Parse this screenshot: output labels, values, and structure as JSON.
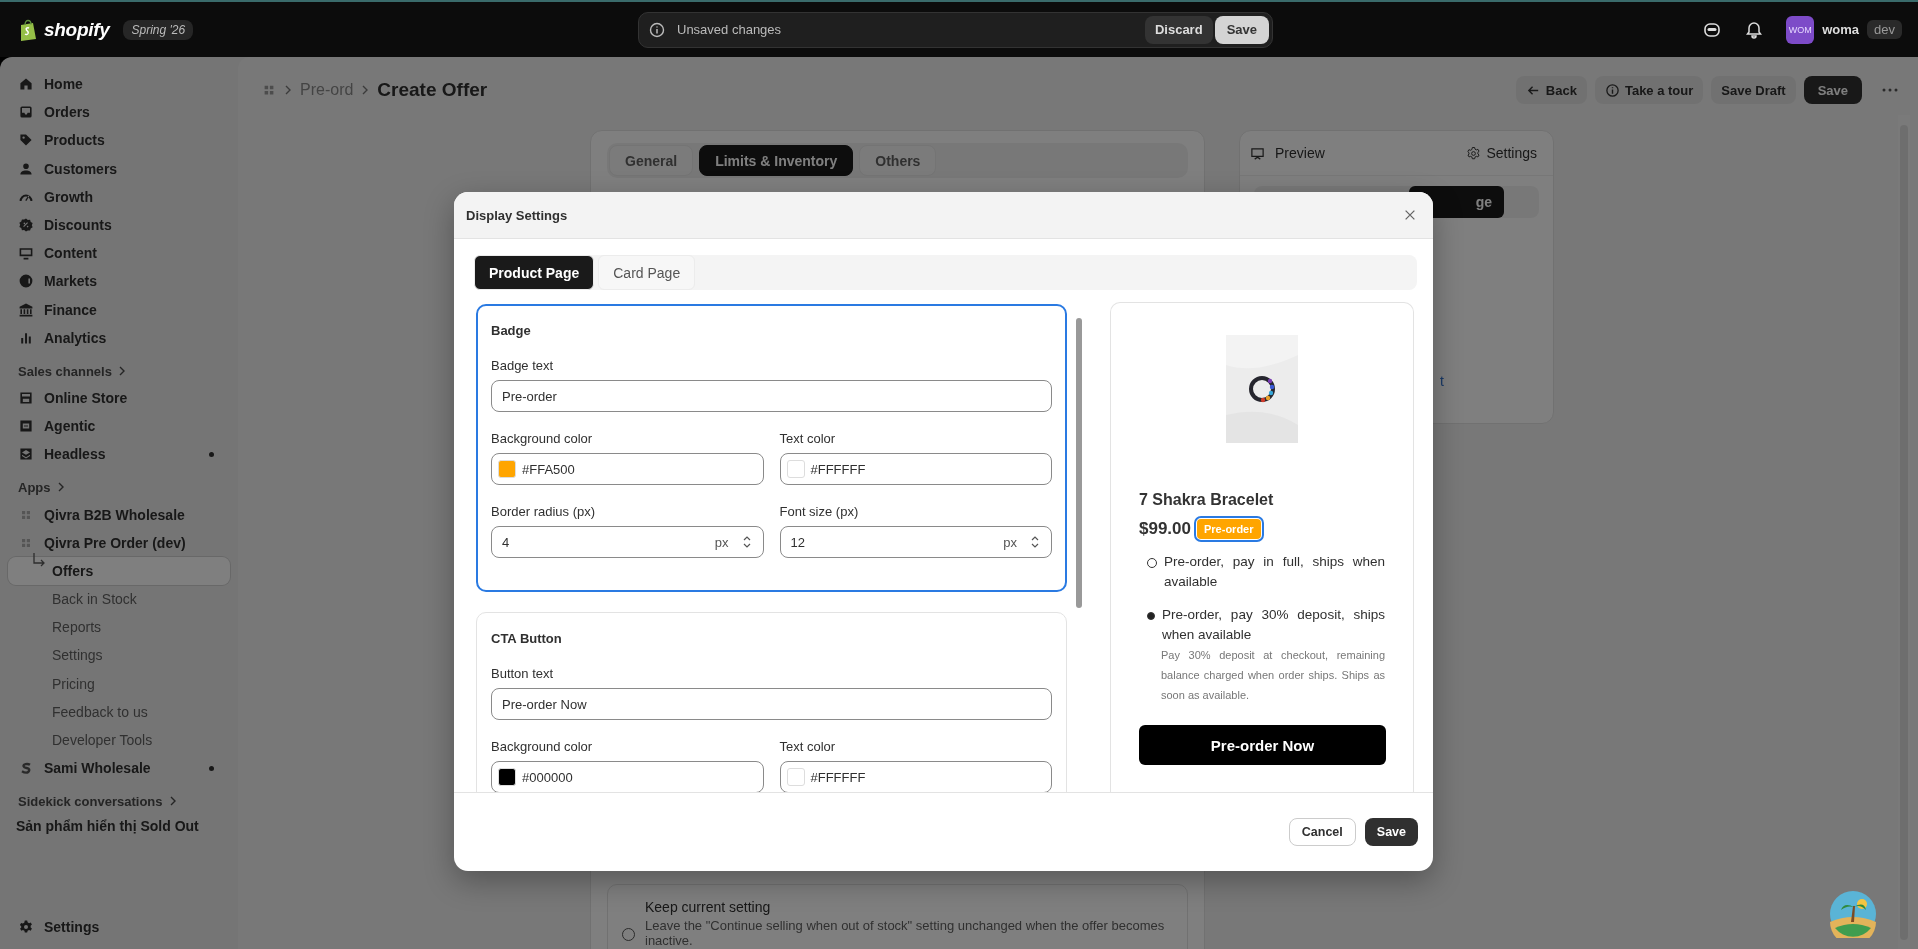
{
  "topbar": {
    "logo_text": "shopify",
    "store_badge": "Spring '26",
    "unsaved": {
      "message": "Unsaved changes",
      "discard": "Discard",
      "save": "Save"
    },
    "avatar": "WOM",
    "user": "woma",
    "env_badge": "dev"
  },
  "sidebar": {
    "main_items": [
      {
        "label": "Home",
        "selected": false
      },
      {
        "label": "Orders",
        "selected": false
      },
      {
        "label": "Products",
        "selected": false
      },
      {
        "label": "Customers",
        "selected": false
      },
      {
        "label": "Growth",
        "selected": false
      },
      {
        "label": "Discounts",
        "selected": false
      },
      {
        "label": "Content",
        "selected": false
      },
      {
        "label": "Markets",
        "selected": false
      },
      {
        "label": "Finance",
        "selected": false
      },
      {
        "label": "Analytics",
        "selected": false
      }
    ],
    "sales_channels": {
      "heading": "Sales channels",
      "items": [
        {
          "label": "Online Store",
          "selected": false,
          "dot": false
        },
        {
          "label": "Agentic",
          "selected": false,
          "dot": false
        },
        {
          "label": "Headless",
          "selected": false,
          "dot": true
        }
      ]
    },
    "apps": {
      "heading": "Apps",
      "items": [
        {
          "label": "Qivra B2B Wholesale",
          "selected": false,
          "dot": false
        },
        {
          "label": "Qivra Pre Order (dev)",
          "selected": false,
          "dot": false,
          "children": [
            {
              "label": "Offers",
              "selected": true
            },
            {
              "label": "Back in Stock",
              "selected": false
            },
            {
              "label": "Reports",
              "selected": false
            },
            {
              "label": "Settings",
              "selected": false
            },
            {
              "label": "Pricing",
              "selected": false
            },
            {
              "label": "Feedback to us",
              "selected": false
            },
            {
              "label": "Developer Tools",
              "selected": false
            }
          ]
        },
        {
          "label": "Sami Wholesale",
          "selected": false,
          "dot": true
        }
      ]
    },
    "sidekick": {
      "heading": "Sidekick conversations",
      "items": [
        "Sản phẩm hiển thị Sold Out"
      ]
    },
    "footer_item": "Settings"
  },
  "page_header": {
    "crumb": "Pre-ord",
    "title": "Create Offer",
    "actions": [
      "Back",
      "Take a tour",
      "Save Draft"
    ],
    "primary": "Save"
  },
  "tabs": [
    {
      "label": "General",
      "selected": false
    },
    {
      "label": "Limits & Inventory",
      "selected": true
    },
    {
      "label": "Others",
      "selected": false
    }
  ],
  "option": {
    "title": "Keep current setting",
    "description": "Leave the \"Continue selling when out of stock\" setting unchanged when the offer becomes inactive.",
    "selected": false
  },
  "side_card": {
    "preview": "Preview",
    "settings": "Settings",
    "partial_button": "ge",
    "partial_link": "t"
  },
  "modal": {
    "title": "Display Settings",
    "tabs": [
      {
        "label": "Product Page",
        "selected": true
      },
      {
        "label": "Card Page",
        "selected": false
      }
    ],
    "sections": [
      {
        "title": "Badge",
        "selected": true,
        "rows": [
          [
            {
              "kind": "text",
              "label": "Badge text",
              "value": "Pre-order"
            }
          ],
          [
            {
              "kind": "color",
              "label": "Background color",
              "value": "#FFA500"
            },
            {
              "kind": "color",
              "label": "Text color",
              "value": "#FFFFFF"
            }
          ],
          [
            {
              "kind": "number",
              "label": "Border radius (px)",
              "value": "4",
              "unit": "px"
            },
            {
              "kind": "number",
              "label": "Font size (px)",
              "value": "12",
              "unit": "px"
            }
          ]
        ]
      },
      {
        "title": "CTA Button",
        "selected": false,
        "rows": [
          [
            {
              "kind": "text",
              "label": "Button text",
              "value": "Pre-order Now"
            }
          ],
          [
            {
              "kind": "color",
              "label": "Background color",
              "value": "#000000"
            },
            {
              "kind": "color",
              "label": "Text color",
              "value": "#FFFFFF"
            }
          ]
        ]
      }
    ],
    "preview": {
      "title": "7 Shakra Bracelet",
      "price": "$99.00",
      "badge": "Pre-order",
      "options": [
        {
          "label": "Pre-order, pay in full, ships when available",
          "selected": false
        },
        {
          "label": "Pre-order, pay 30% deposit, ships when available",
          "selected": true,
          "note": "Pay 30% deposit at checkout, remaining balance charged when order ships. Ships as soon as available."
        }
      ],
      "button": "Pre-order Now"
    },
    "cancel": "Cancel",
    "save": "Save"
  }
}
